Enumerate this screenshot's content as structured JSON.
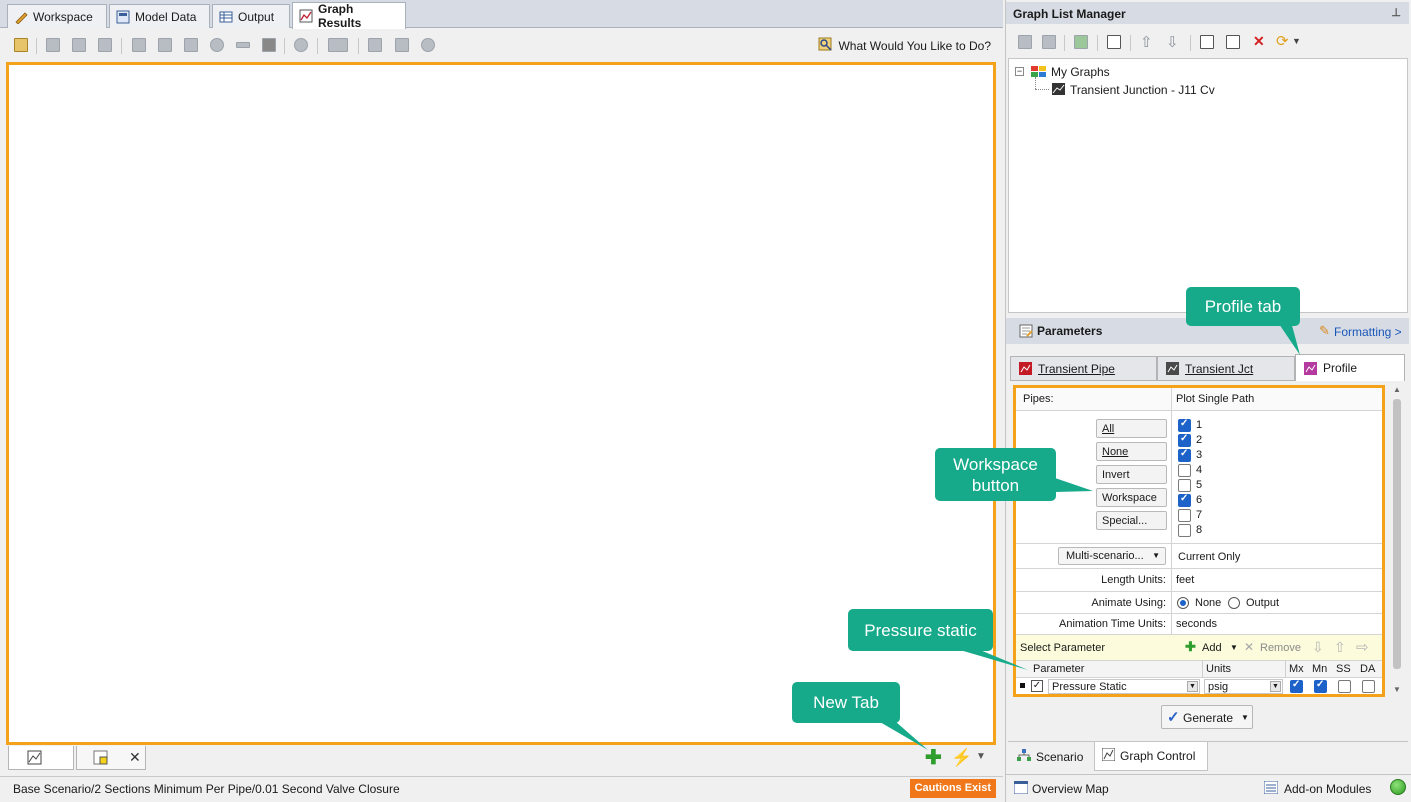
{
  "main_tabs": [
    {
      "label": "Workspace"
    },
    {
      "label": "Model Data"
    },
    {
      "label": "Output"
    },
    {
      "label": "Graph Results"
    }
  ],
  "toolbar": {
    "help_label": "What Would You Like to Do?"
  },
  "status": {
    "scenario_path": "Base Scenario/2 Sections Minimum Per Pipe/0.01 Second Valve Closure",
    "cautions": "Cautions Exist"
  },
  "graph_list_manager": {
    "title": "Graph List Manager",
    "tree_root": "My Graphs",
    "tree_child": "Transient Junction - J11 Cv"
  },
  "parameters": {
    "title": "Parameters",
    "formatting_link": "Formatting >",
    "tabs": [
      {
        "label": "Transient Pipe"
      },
      {
        "label": "Transient Jct"
      },
      {
        "label": "Profile"
      }
    ],
    "pipes_label": "Pipes:",
    "pipes_mode": "Plot Single Path",
    "buttons": {
      "all": "All",
      "none": "None",
      "invert": "Invert",
      "workspace": "Workspace",
      "special": "Special..."
    },
    "pipe_items": [
      {
        "label": "1",
        "checked": true
      },
      {
        "label": "2",
        "checked": true
      },
      {
        "label": "3",
        "checked": true
      },
      {
        "label": "4",
        "checked": false
      },
      {
        "label": "5",
        "checked": false
      },
      {
        "label": "6",
        "checked": true
      },
      {
        "label": "7",
        "checked": false
      },
      {
        "label": "8",
        "checked": false
      }
    ],
    "multi_scenario": "Multi-scenario...",
    "multi_scenario_value": "Current Only",
    "length_units_label": "Length Units:",
    "length_units_value": "feet",
    "animate_label": "Animate Using:",
    "animate_none": "None",
    "animate_output": "Output",
    "anim_time_label": "Animation Time Units:",
    "anim_time_value": "seconds",
    "select_parameter": "Select Parameter",
    "add_label": "Add",
    "remove_label": "Remove",
    "col_parameter": "Parameter",
    "col_units": "Units",
    "col_mx": "Mx",
    "col_mn": "Mn",
    "col_ss": "SS",
    "col_da": "DA",
    "row_parameter": "Pressure Static",
    "row_units": "psig",
    "generate_label": "Generate"
  },
  "bottom_tabs": {
    "scenario": "Scenario",
    "graph_control": "Graph Control",
    "overview_map": "Overview Map",
    "addon_modules": "Add-on Modules"
  },
  "callouts": {
    "profile_tab": "Profile tab",
    "workspace_button": "Workspace\nbutton",
    "pressure_static": "Pressure static",
    "new_tab": "New Tab"
  },
  "colors": {
    "highlight": "#f5a21b",
    "callout": "#16a98a",
    "caution": "#f0771a",
    "check_blue": "#1c62c9"
  }
}
